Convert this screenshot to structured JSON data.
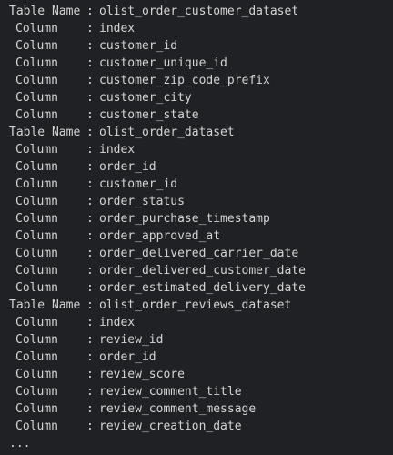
{
  "output": {
    "table_label": "Table Name",
    "column_label": "Column",
    "separator": ":",
    "ellipsis": "...",
    "tables": [
      {
        "name": "olist_order_customer_dataset",
        "columns": [
          "index",
          "customer_id",
          "customer_unique_id",
          "customer_zip_code_prefix",
          "customer_city",
          "customer_state"
        ]
      },
      {
        "name": "olist_order_dataset",
        "columns": [
          "index",
          "order_id",
          "customer_id",
          "order_status",
          "order_purchase_timestamp",
          "order_approved_at",
          "order_delivered_carrier_date",
          "order_delivered_customer_date",
          "order_estimated_delivery_date"
        ]
      },
      {
        "name": "olist_order_reviews_dataset",
        "columns": [
          "index",
          "review_id",
          "order_id",
          "review_score",
          "review_comment_title",
          "review_comment_message",
          "review_creation_date"
        ]
      }
    ]
  }
}
